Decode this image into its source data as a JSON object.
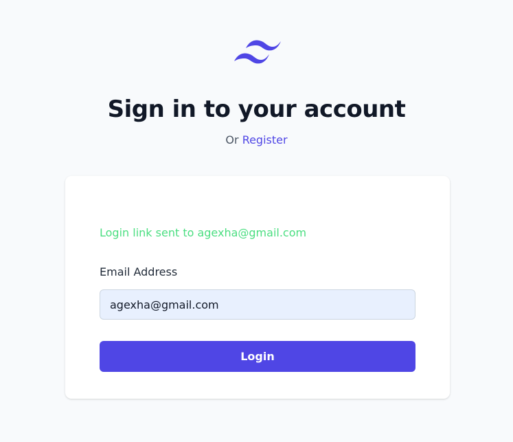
{
  "brand": {
    "logo_icon": "tailwind-wave-logo-icon",
    "accent_color": "#4f46e5"
  },
  "header": {
    "title": "Sign in to your account",
    "subtitle_prefix": "Or",
    "register_link": "Register"
  },
  "form": {
    "status_message": "Login link sent to agexha@gmail.com",
    "status_color": "#4ade80",
    "email_label": "Email Address",
    "email_value": "agexha@gmail.com",
    "submit_label": "Login"
  }
}
